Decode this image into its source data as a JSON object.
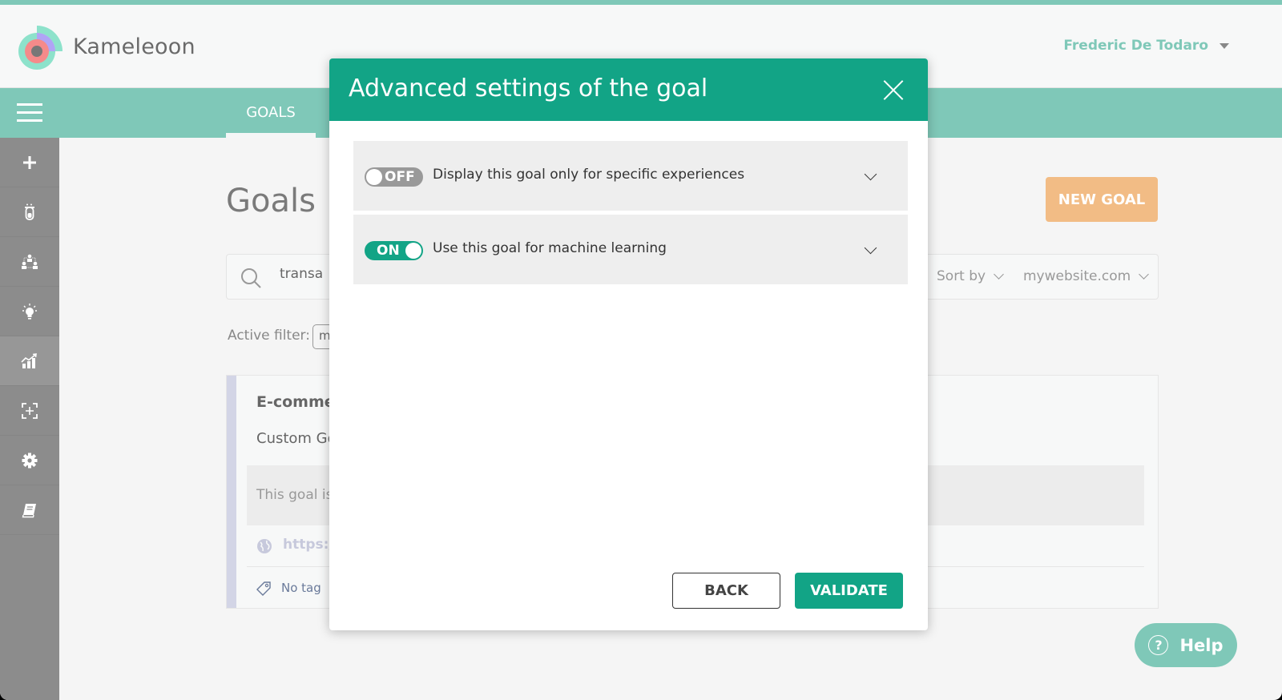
{
  "header": {
    "brand": "Kameleoon",
    "user_name": "Frederic De Todaro"
  },
  "navbar": {
    "active_tab": "GOALS"
  },
  "sidebar": {
    "items": [
      {
        "icon": "plus-icon",
        "label": "Create"
      },
      {
        "icon": "test-tube-icon",
        "label": "Experiments"
      },
      {
        "icon": "personalization-icon",
        "label": "Personalizations"
      },
      {
        "icon": "lightbulb-icon",
        "label": "Ideas"
      },
      {
        "icon": "chart-icon",
        "label": "Goals",
        "active": true
      },
      {
        "icon": "target-add-icon",
        "label": "Add element"
      },
      {
        "icon": "gear-icon",
        "label": "Settings"
      },
      {
        "icon": "book-icon",
        "label": "Documentation"
      }
    ]
  },
  "main": {
    "page_title": "Goals",
    "new_goal_label": "NEW GOAL",
    "search": {
      "value": "transa",
      "sort_by_label": "Sort by",
      "site_select_value": "mywebsite.com"
    },
    "active_filter_label": "Active filter:",
    "active_filter_chip": "m",
    "goal_card": {
      "name": "E-comme",
      "type": "Custom Go",
      "description": "This goal is",
      "url": "https:/",
      "tag": "No tag"
    }
  },
  "help": {
    "label": "Help"
  },
  "modal": {
    "title": "Advanced settings of the goal",
    "settings": [
      {
        "toggle_state": "OFF",
        "label": "Display this goal only for specific experiences",
        "enabled": false
      },
      {
        "toggle_state": "ON",
        "label": "Use this goal for machine learning",
        "enabled": true
      }
    ],
    "back_label": "BACK",
    "validate_label": "VALIDATE"
  },
  "colors": {
    "brand_teal": "#7fc8b8",
    "modal_green": "#12a486",
    "new_goal_orange": "#f2bc85",
    "sidebar_gray": "#8c8c8c"
  }
}
